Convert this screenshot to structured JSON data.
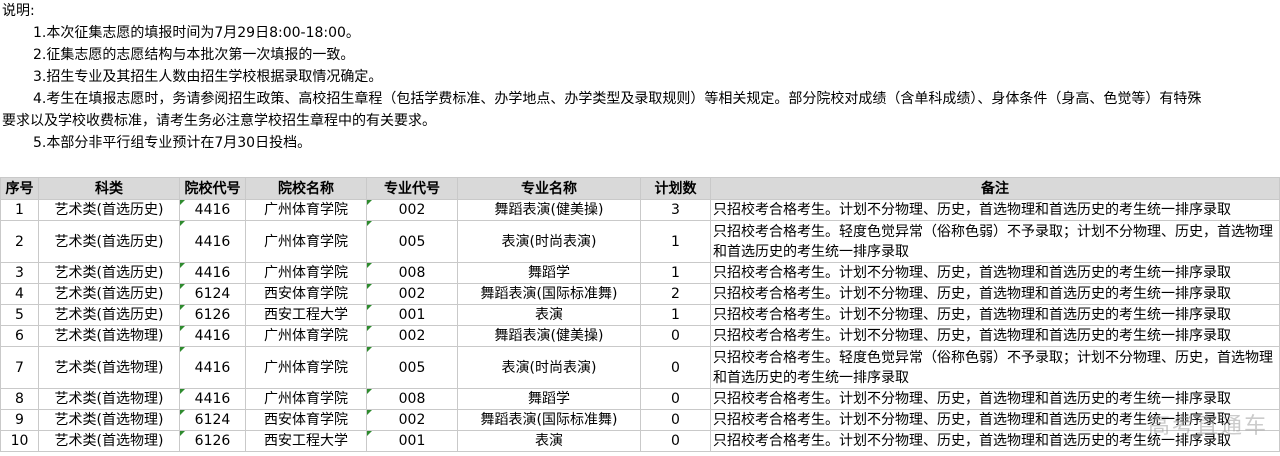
{
  "notes": {
    "title": "说明:",
    "items": [
      "1.本次征集志愿的填报时间为7月29日8:00-18:00。",
      "2.征集志愿的志愿结构与本批次第一次填报的一致。",
      "3.招生专业及其招生人数由招生学校根据录取情况确定。",
      "4.考生在填报志愿时，务请参阅招生政策、高校招生章程（包括学费标准、办学地点、办学类型及录取规则）等相关规定。部分院校对成绩（含单科成绩）、身体条件（身高、色觉等）有特殊",
      "要求以及学校收费标准，请考生务必注意学校招生章程中的有关要求。",
      "5.本部分非平行组专业预计在7月30日投档。"
    ]
  },
  "table": {
    "headers": [
      "序号",
      "科类",
      "院校代号",
      "院校名称",
      "专业代号",
      "专业名称",
      "计划数",
      "备注"
    ],
    "rows": [
      [
        "1",
        "艺术类(首选历史)",
        "4416",
        "广州体育学院",
        "002",
        "舞蹈表演(健美操)",
        "3",
        "只招校考合格考生。计划不分物理、历史，首选物理和首选历史的考生统一排序录取"
      ],
      [
        "2",
        "艺术类(首选历史)",
        "4416",
        "广州体育学院",
        "005",
        "表演(时尚表演)",
        "1",
        "只招校考合格考生。轻度色觉异常（俗称色弱）不予录取；计划不分物理、历史，首选物理和首选历史的考生统一排序录取"
      ],
      [
        "3",
        "艺术类(首选历史)",
        "4416",
        "广州体育学院",
        "008",
        "舞蹈学",
        "1",
        "只招校考合格考生。计划不分物理、历史，首选物理和首选历史的考生统一排序录取"
      ],
      [
        "4",
        "艺术类(首选历史)",
        "6124",
        "西安体育学院",
        "002",
        "舞蹈表演(国际标准舞)",
        "2",
        "只招校考合格考生。计划不分物理、历史，首选物理和首选历史的考生统一排序录取"
      ],
      [
        "5",
        "艺术类(首选历史)",
        "6126",
        "西安工程大学",
        "001",
        "表演",
        "1",
        "只招校考合格考生。计划不分物理、历史，首选物理和首选历史的考生统一排序录取"
      ],
      [
        "6",
        "艺术类(首选物理)",
        "4416",
        "广州体育学院",
        "002",
        "舞蹈表演(健美操)",
        "0",
        "只招校考合格考生。计划不分物理、历史，首选物理和首选历史的考生统一排序录取"
      ],
      [
        "7",
        "艺术类(首选物理)",
        "4416",
        "广州体育学院",
        "005",
        "表演(时尚表演)",
        "0",
        "只招校考合格考生。轻度色觉异常（俗称色弱）不予录取；计划不分物理、历史，首选物理和首选历史的考生统一排序录取"
      ],
      [
        "8",
        "艺术类(首选物理)",
        "4416",
        "广州体育学院",
        "008",
        "舞蹈学",
        "0",
        "只招校考合格考生。计划不分物理、历史，首选物理和首选历史的考生统一排序录取"
      ],
      [
        "9",
        "艺术类(首选物理)",
        "6124",
        "西安体育学院",
        "002",
        "舞蹈表演(国际标准舞)",
        "0",
        "只招校考合格考生。计划不分物理、历史，首选物理和首选历史的考生统一排序录取"
      ],
      [
        "10",
        "艺术类(首选物理)",
        "6126",
        "西安工程大学",
        "001",
        "表演",
        "0",
        "只招校考合格考生。计划不分物理、历史，首选物理和首选历史的考生统一排序录取"
      ]
    ]
  },
  "watermark": "高考直通车"
}
